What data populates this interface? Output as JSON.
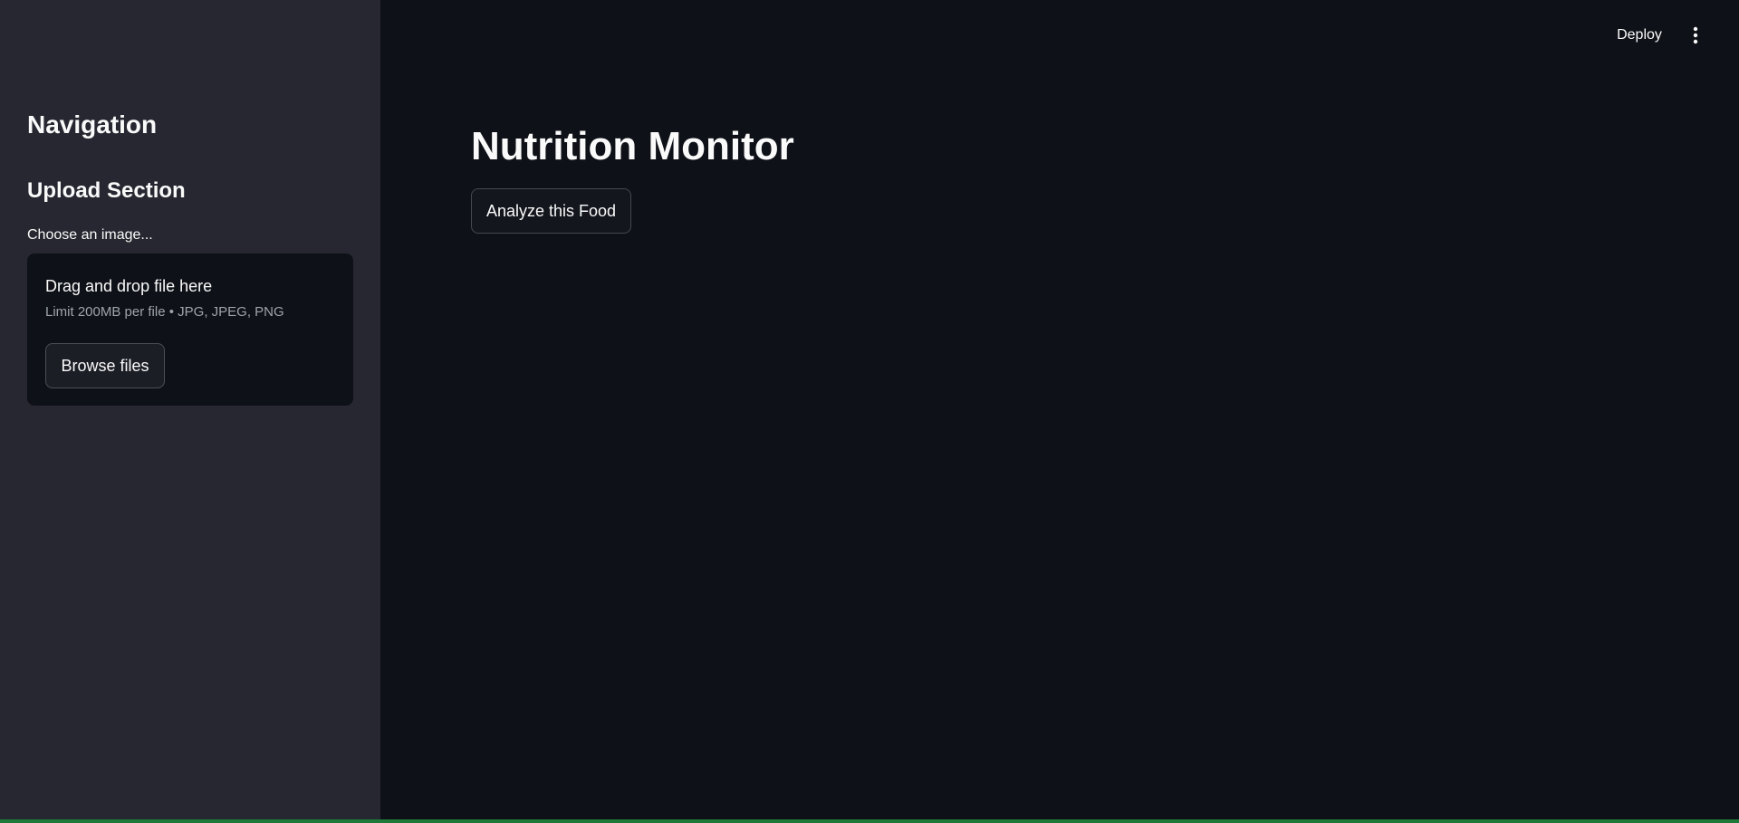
{
  "sidebar": {
    "nav_title": "Navigation",
    "section_title": "Upload Section",
    "uploader": {
      "label": "Choose an image...",
      "drop_text": "Drag and drop file here",
      "limit_text": "Limit 200MB per file • JPG, JPEG, PNG",
      "browse_label": "Browse files"
    }
  },
  "header": {
    "deploy_label": "Deploy",
    "menu_icon": "more-vertical-icon"
  },
  "main": {
    "title": "Nutrition Monitor",
    "analyze_label": "Analyze this Food"
  },
  "colors": {
    "sidebar_bg": "#262730",
    "main_bg": "#0e1117",
    "text": "#fafafa",
    "muted_text": "#9ea3ad",
    "status_bar": "#1f7a3a"
  }
}
